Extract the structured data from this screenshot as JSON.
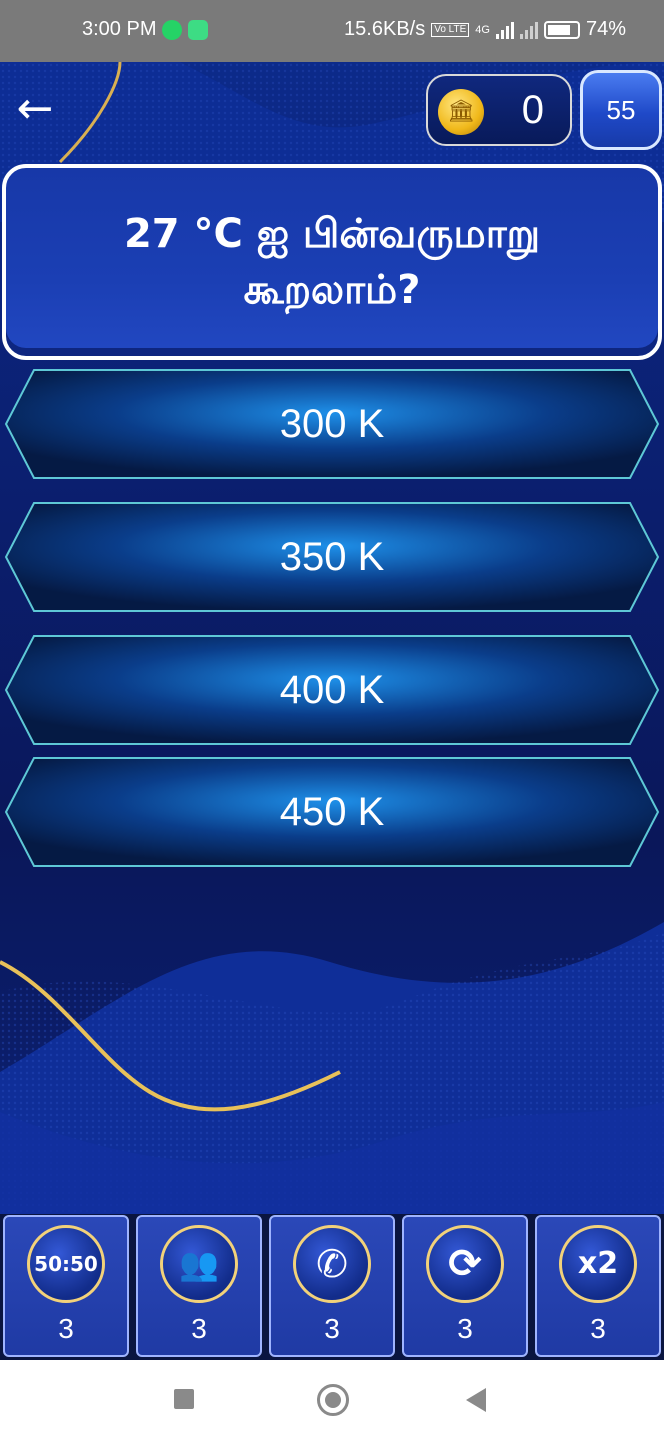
{
  "status_bar": {
    "time": "3:00 PM",
    "network_speed": "15.6KB/s",
    "volte_tag": "Vo LTE",
    "network_type": "4G",
    "battery": "74%"
  },
  "header": {
    "coins": "0",
    "timer": "55"
  },
  "question": {
    "text": "27 °C ஐ பின்வருமாறு கூறலாம்?"
  },
  "answers": [
    {
      "label": "300 K"
    },
    {
      "label": "350 K"
    },
    {
      "label": "400 K"
    },
    {
      "label": "450 K"
    }
  ],
  "lifelines": [
    {
      "icon": "fifty-fifty-icon",
      "symbol": "50:50",
      "count": "3"
    },
    {
      "icon": "audience-poll-icon",
      "symbol": "👥",
      "count": "3"
    },
    {
      "icon": "phone-a-friend-icon",
      "symbol": "✆",
      "count": "3"
    },
    {
      "icon": "swap-question-icon",
      "symbol": "⟳",
      "count": "3"
    },
    {
      "icon": "double-dip-icon",
      "symbol": "x2",
      "count": "3"
    }
  ],
  "colors": {
    "background": "#0a1a5c",
    "gold_accent": "#e8c15a",
    "answer_border": "#5ec8d6"
  }
}
